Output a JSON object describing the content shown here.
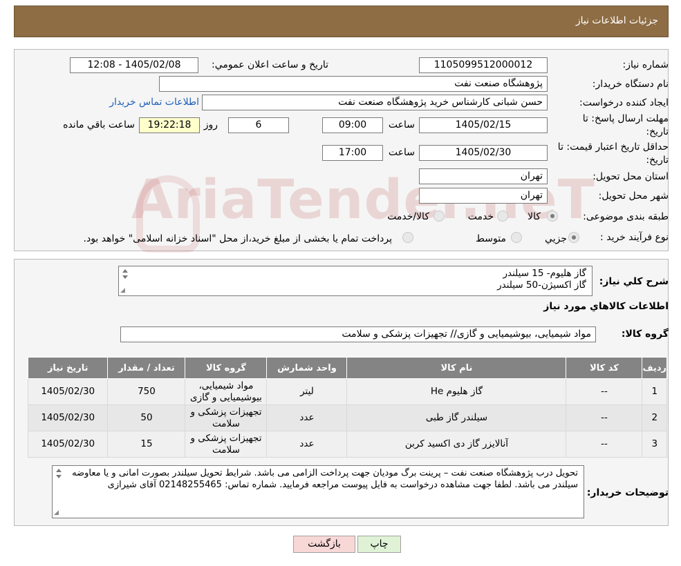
{
  "header": {
    "title": "جزئیات اطلاعات نیاز"
  },
  "info": {
    "need_number_label": "شماره نیاز:",
    "need_number": "1105099512000012",
    "announce_label": "تاريخ و ساعت اعلان عمومي:",
    "announce_value": "1405/02/08 - 12:08",
    "buyer_org_label": "نام دستگاه خريدار:",
    "buyer_org": "پژوهشگاه صنعت نفت",
    "creator_label": "ايجاد كننده درخواست:",
    "creator": "حسن شبانی کارشناس خرید پژوهشگاه صنعت نفت",
    "contact_link": "اطلاعات تماس خریدار",
    "deadline_label_1": "مهلت ارسال پاسخ: تا",
    "deadline_label_2": "تاريخ:",
    "deadline_date": "1405/02/15",
    "time_label": "ساعت",
    "deadline_time": "09:00",
    "days_value": "6",
    "days_label": "روز و",
    "remaining_time": "19:22:18",
    "remaining_label": "ساعت باقي مانده",
    "validity_label_1": "حداقل تاريخ اعتبار قيمت: تا",
    "validity_label_2": "تاريخ:",
    "validity_date": "1405/02/30",
    "validity_time": "17:00",
    "province_label": "استان محل تحويل:",
    "province": "تهران",
    "city_label": "شهر محل تحويل:",
    "city": "تهران",
    "category_label": "طبقه بندی موضوعی:",
    "category_options": [
      "كالا",
      "خدمت",
      "كالا/خدمت"
    ],
    "category_selected": "كالا",
    "process_label": "نوع فرآيند خريد :",
    "process_options": [
      "جزيي",
      "متوسط"
    ],
    "process_selected": "جزيي",
    "payment_note": "پرداخت تمام يا بخشی از مبلغ خريد،از محل \"اسناد خزانه اسلامی\" خواهد بود."
  },
  "details": {
    "summary_label": "شرح كلي نياز:",
    "summary_text": "گاز هلیوم- 15 سیلندر\nگاز اکسیژن-50 سیلندر",
    "goods_info_title": "اطلاعات كالاهاي مورد نياز",
    "goods_group_label": "گروه كالا:",
    "goods_group": "مواد شیمیایی، بیوشیمیایی و  گازی// تجهیزات پزشکی و سلامت"
  },
  "table": {
    "headers": [
      "رديف",
      "كد كالا",
      "نام كالا",
      "واحد شمارش",
      "گروه كالا",
      "تعداد / مقدار",
      "تاريخ نياز"
    ],
    "rows": [
      [
        "1",
        "--",
        "گاز هلیوم He",
        "ليتر",
        "مواد شیمیایی، بیوشیمیایی و گازی",
        "750",
        "1405/02/30"
      ],
      [
        "2",
        "--",
        "سیلندر گاز طبی",
        "عدد",
        "تجهیزات پزشکی و سلامت",
        "50",
        "1405/02/30"
      ],
      [
        "3",
        "--",
        "آنالایزر گاز دی اکسید کربن",
        "عدد",
        "تجهیزات پزشکی و سلامت",
        "15",
        "1405/02/30"
      ]
    ]
  },
  "notes": {
    "label": "توضيحات خريدار:",
    "text": "تحویل درب پژوهشگاه صنعت نفت – پرینت برگ مودیان جهت پرداخت الزامی می باشد. شرایط تحویل سیلندر بصورت امانی و یا معاوضه سیلندر می باشد. لطفا جهت مشاهده درخواست به فایل پیوست مراجعه فرمایید. شماره تماس: 02148255465 آقای شیرازی"
  },
  "buttons": {
    "print": "چاپ",
    "back": "بازگشت"
  },
  "watermark": "AriaTender.neT",
  "colors": {
    "header": "#8e6d44",
    "table_header": "#848484",
    "back_button": "#f8d7d7",
    "print_button": "#dff2d6",
    "link": "#1f5fb8"
  }
}
